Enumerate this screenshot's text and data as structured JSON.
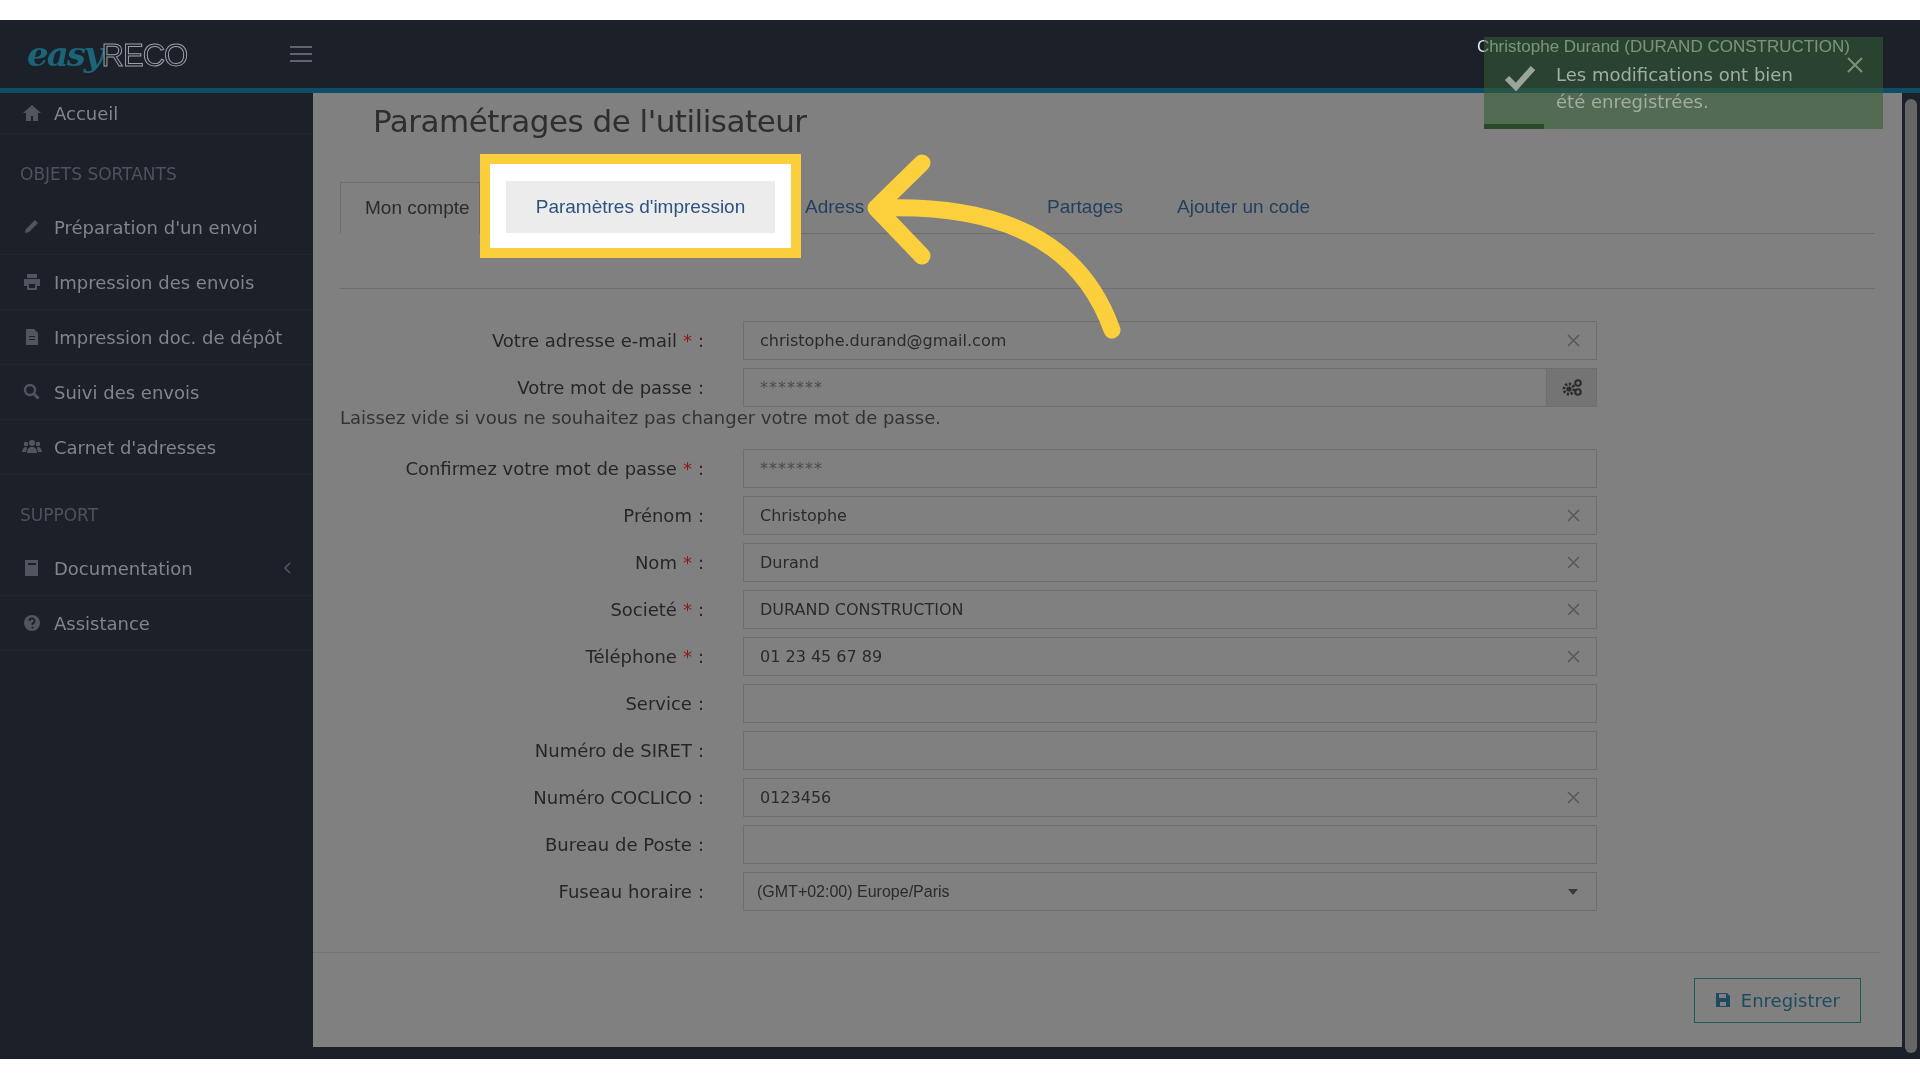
{
  "header": {
    "logo": {
      "bold": "easy",
      "light": "RECO"
    },
    "user": "Christophe Durand (DURAND CONSTRUCTION)"
  },
  "toast": {
    "message": "Les modifications ont bien été enregistrées.",
    "level": 0.15
  },
  "sidebar": {
    "items": [
      {
        "kind": "item",
        "label": "Accueil"
      },
      {
        "kind": "header",
        "label": "OBJETS SORTANTS"
      },
      {
        "kind": "item",
        "label": "Préparation d'un envoi"
      },
      {
        "kind": "item",
        "label": "Impression des envois"
      },
      {
        "kind": "item",
        "label": "Impression doc. de dépôt"
      },
      {
        "kind": "item",
        "label": "Suivi des envois"
      },
      {
        "kind": "item",
        "label": "Carnet d'adresses"
      },
      {
        "kind": "header",
        "label": "SUPPORT"
      },
      {
        "kind": "item",
        "label": "Documentation",
        "expandable": true
      },
      {
        "kind": "item",
        "label": "Assistance"
      }
    ]
  },
  "page": {
    "title": "Paramétrages de l'utilisateur"
  },
  "tabs": [
    {
      "label": "Mon compte",
      "selected": true,
      "highlighted": false
    },
    {
      "label": "Paramètres d'impression",
      "selected": false,
      "highlighted": true
    },
    {
      "label": "Adress",
      "selected": false,
      "highlighted": false
    },
    {
      "label": "Partages",
      "selected": false,
      "highlighted": false
    },
    {
      "label": "Ajouter un code",
      "selected": false,
      "highlighted": false
    }
  ],
  "form": [
    {
      "kind": "text",
      "label": "Votre adresse e-mail",
      "asterisk": "*",
      "colon": ":",
      "value": "christophe.durand@gmail.com",
      "clearable": true
    },
    {
      "kind": "password",
      "label": "Votre mot de passe",
      "colon": ":",
      "value": "*******",
      "clearable": false,
      "generator": true
    },
    {
      "kind": "hint",
      "text": "Laissez vide si vous ne souhaitez pas changer votre mot de passe."
    },
    {
      "kind": "password",
      "label": "Confirmez votre mot de passe",
      "asterisk": "*",
      "colon": ":",
      "value": "*******",
      "clearable": false
    },
    {
      "kind": "text",
      "label": "Prénom",
      "colon": ":",
      "value": "Christophe",
      "clearable": true
    },
    {
      "kind": "text",
      "label": "Nom",
      "asterisk": "*",
      "colon": ":",
      "value": "Durand",
      "clearable": true
    },
    {
      "kind": "text",
      "label": "Societé",
      "asterisk": "*",
      "colon": ":",
      "value": "DURAND CONSTRUCTION",
      "clearable": true
    },
    {
      "kind": "text",
      "label": "Téléphone",
      "asterisk": "*",
      "colon": ":",
      "value": "01 23 45 67 89",
      "clearable": true
    },
    {
      "kind": "text",
      "label": "Service",
      "colon": ":",
      "clearable": false
    },
    {
      "kind": "text",
      "label": "Numéro de SIRET",
      "colon": ":",
      "clearable": false
    },
    {
      "kind": "text",
      "label": "Numéro COCLICO",
      "colon": ":",
      "value": "0123456",
      "clearable": true
    },
    {
      "kind": "text",
      "label": "Bureau de Poste",
      "colon": ":",
      "clearable": false
    },
    {
      "kind": "select",
      "label": "Fuseau horaire",
      "colon": ":",
      "value": "(GMT+02:00) Europe/Paris"
    }
  ],
  "save_button": {
    "label": "Enregistrer"
  }
}
